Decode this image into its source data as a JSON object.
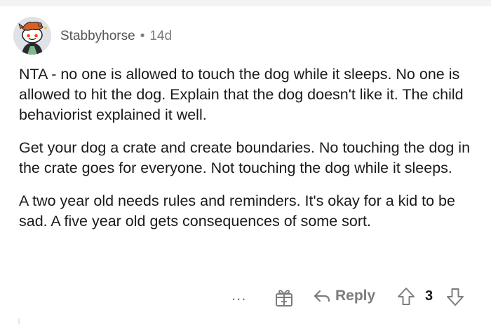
{
  "comment": {
    "author": "Stabbyhorse",
    "separator": "•",
    "age": "14d",
    "paragraphs": [
      "NTA - no one is allowed to touch the dog while it sleeps. No one is allowed to hit the dog. Explain that the dog doesn't like it. The child behaviorist explained it well.",
      "Get your dog a crate and create boundaries. No touching the dog in the crate goes for everyone. Not touching the dog while it sleeps.",
      "A two year old needs rules and reminders. It's okay for a kid to be sad. A five year old gets consequences of some sort."
    ],
    "avatar_icon": "snoo-avatar-icon"
  },
  "actions": {
    "more_label": "...",
    "award_icon": "gift-icon",
    "reply_icon": "reply-arrow-icon",
    "reply_label": "Reply",
    "upvote_icon": "upvote-arrow-icon",
    "score": "3",
    "downvote_icon": "downvote-arrow-icon"
  },
  "colors": {
    "text_primary": "#1a1a1b",
    "text_muted": "#7c7c7c",
    "background": "#ffffff",
    "top_strip": "#f3f3f3"
  }
}
